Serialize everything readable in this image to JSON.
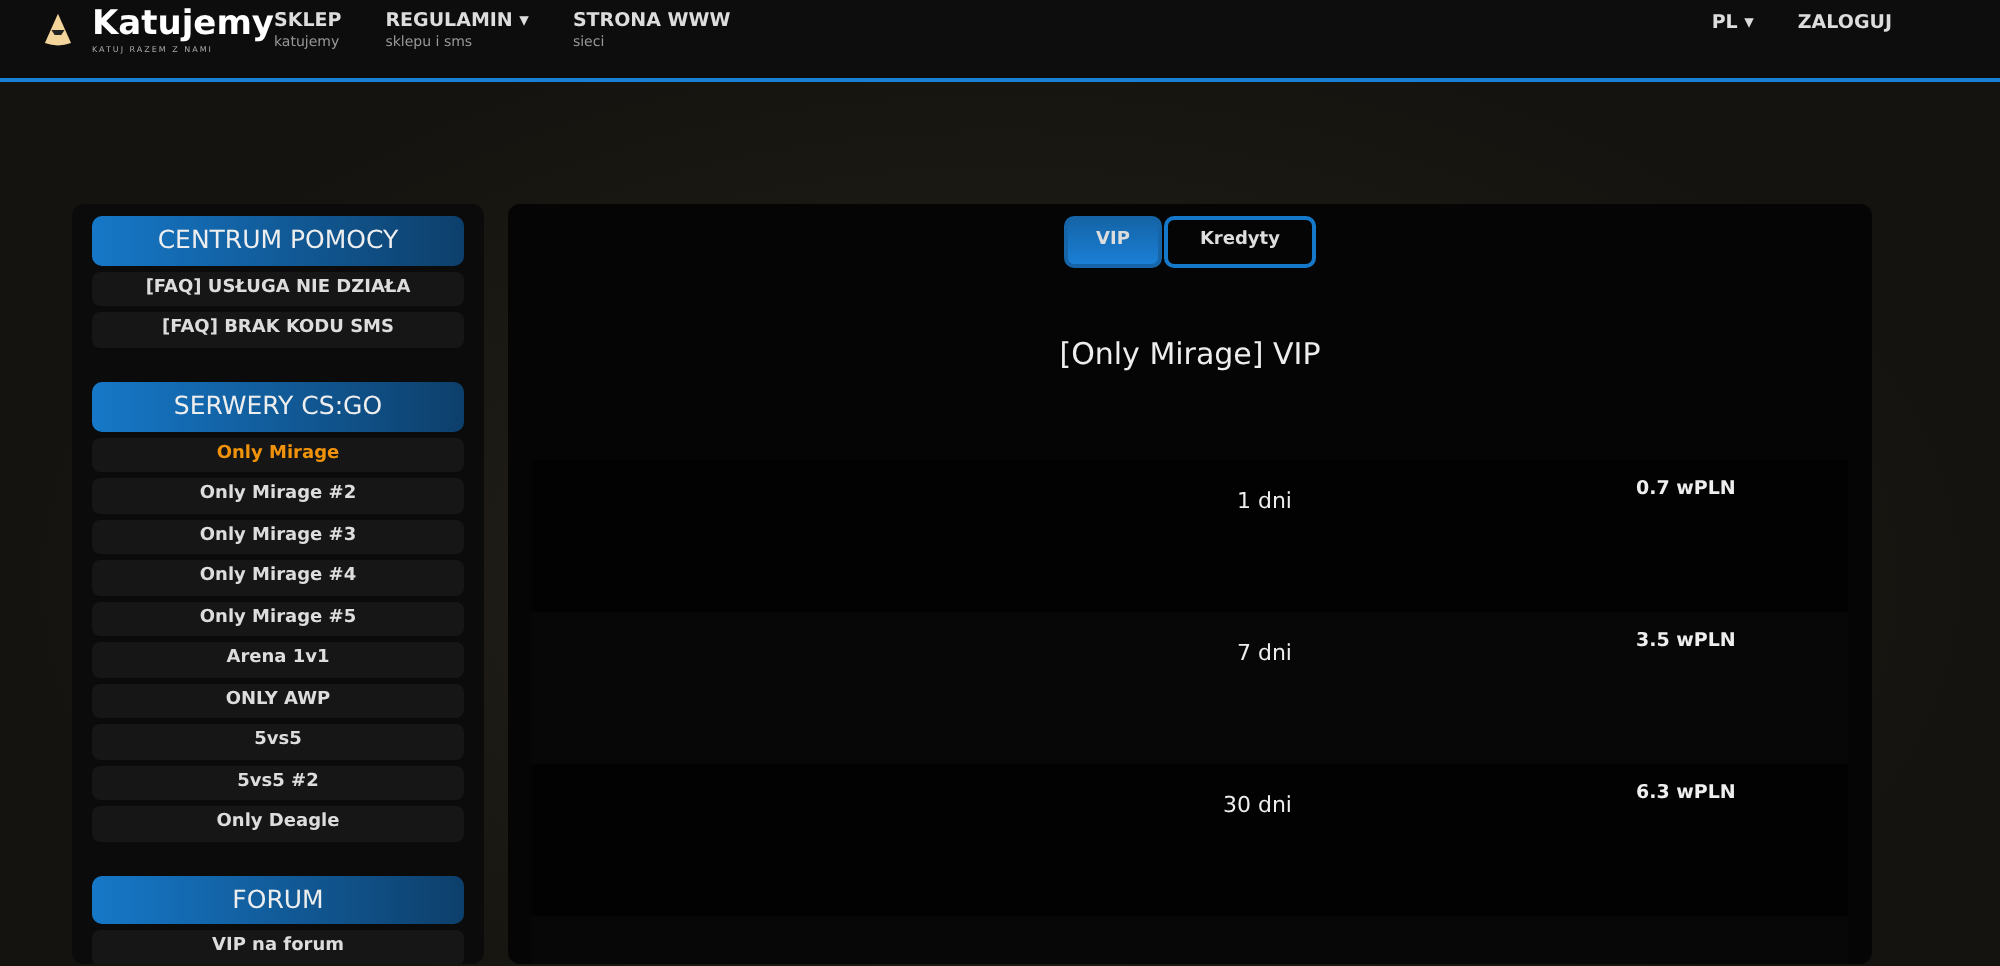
{
  "navbar": {
    "brand": "Katujemy",
    "tagline": "KATUJ RAZEM Z NAMI",
    "links": [
      {
        "label": "SKLEP",
        "sub": "katujemy",
        "dropdown": false
      },
      {
        "label": "REGULAMIN",
        "sub": "sklepu i sms",
        "dropdown": true
      },
      {
        "label": "STRONA WWW",
        "sub": "sieci",
        "dropdown": false
      }
    ],
    "right": [
      {
        "label": "PL",
        "dropdown": true
      },
      {
        "label": "ZALOGUJ",
        "dropdown": false
      }
    ],
    "caret": "▾"
  },
  "sidebar": [
    {
      "title": "CENTRUM POMOCY",
      "items": [
        {
          "label": "[FAQ] USŁUGA NIE DZIAŁA",
          "selected": false
        },
        {
          "label": "[FAQ] BRAK KODU SMS",
          "selected": false
        }
      ]
    },
    {
      "title": "SERWERY CS:GO",
      "items": [
        {
          "label": "Only Mirage",
          "selected": true
        },
        {
          "label": "Only Mirage #2",
          "selected": false
        },
        {
          "label": "Only Mirage #3",
          "selected": false
        },
        {
          "label": "Only Mirage #4",
          "selected": false
        },
        {
          "label": "Only Mirage #5",
          "selected": false
        },
        {
          "label": "Arena 1v1",
          "selected": false
        },
        {
          "label": "ONLY AWP",
          "selected": false
        },
        {
          "label": "5vs5",
          "selected": false
        },
        {
          "label": "5vs5 #2",
          "selected": false
        },
        {
          "label": "Only Deagle",
          "selected": false
        }
      ]
    },
    {
      "title": "FORUM",
      "items": [
        {
          "label": "VIP na forum",
          "selected": false
        }
      ]
    }
  ],
  "tabs": [
    {
      "label": "VIP",
      "selected": true
    },
    {
      "label": "Kredyty",
      "selected": false
    }
  ],
  "heading": "[Only Mirage] VIP",
  "offers": [
    {
      "duration": "1 dni",
      "price": "0.7 wPLN"
    },
    {
      "duration": "7 dni",
      "price": "3.5 wPLN"
    },
    {
      "duration": "30 dni",
      "price": "6.3 wPLN"
    }
  ]
}
